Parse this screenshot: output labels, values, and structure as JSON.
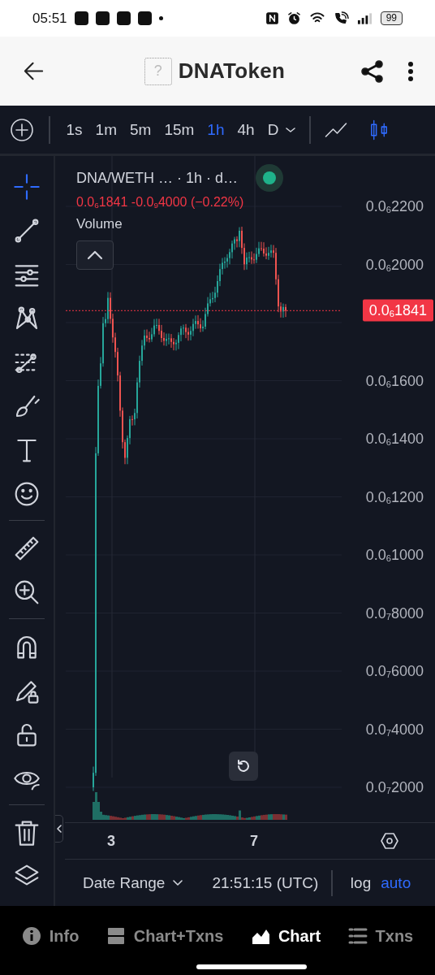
{
  "status_bar": {
    "time": "05:51",
    "battery": "99"
  },
  "header": {
    "token_placeholder": "?",
    "title": "DNAToken"
  },
  "toolbar": {
    "intervals": [
      {
        "label": "1s",
        "selected": false
      },
      {
        "label": "1m",
        "selected": false
      },
      {
        "label": "5m",
        "selected": false
      },
      {
        "label": "15m",
        "selected": false
      },
      {
        "label": "1h",
        "selected": true
      },
      {
        "label": "4h",
        "selected": false
      },
      {
        "label": "D",
        "selected": false
      }
    ],
    "chart_types": [
      {
        "kind": "line",
        "selected": false
      },
      {
        "kind": "candles",
        "selected": true
      }
    ]
  },
  "tool_groups": [
    [
      {
        "kind": "crosshair",
        "selected": true
      },
      {
        "kind": "trend-line",
        "selected": false
      },
      {
        "kind": "lines",
        "selected": false
      },
      {
        "kind": "pattern",
        "selected": false
      },
      {
        "kind": "forecast",
        "selected": false
      },
      {
        "kind": "brush",
        "selected": false
      },
      {
        "kind": "text",
        "selected": false
      },
      {
        "kind": "emoji",
        "selected": false
      }
    ],
    [
      {
        "kind": "ruler",
        "selected": false
      },
      {
        "kind": "zoom",
        "selected": false
      }
    ],
    [
      {
        "kind": "magnet",
        "selected": false
      },
      {
        "kind": "lock-drawing",
        "selected": false
      },
      {
        "kind": "unlock",
        "selected": false
      },
      {
        "kind": "eye",
        "selected": false
      }
    ],
    [
      {
        "kind": "trash",
        "selected": false
      },
      {
        "kind": "layers",
        "selected": false
      }
    ]
  ],
  "legend": {
    "symbol": "DNA/WETH …  · 1h · d…",
    "quote": "0.0$_{6}$1841  -0.0$_{9}$4000 (−0.22%)",
    "study": "Volume"
  },
  "price_axis": [
    "0.0$_{6}$2200",
    "0.0$_{6}$2000",
    "0.0$_{6}$1600",
    "0.0$_{6}$1400",
    "0.0$_{6}$1200",
    "0.0$_{6}$1000",
    "0.0$_{7}$8000",
    "0.0$_{7}$6000",
    "0.0$_{7}$4000",
    "0.0$_{7}$2000"
  ],
  "last_price": "0.0$_{6}$1841",
  "time_axis": [
    "3",
    "7"
  ],
  "bottom_bar": {
    "date_range": "Date Range",
    "clock": "21:51:15 (UTC)",
    "scales": [
      {
        "label": "log",
        "selected": false
      },
      {
        "label": "auto",
        "selected": true
      }
    ]
  },
  "nav": [
    {
      "kind": "info",
      "label": "Info",
      "selected": false
    },
    {
      "kind": "split",
      "label": "Chart+Txns",
      "selected": false
    },
    {
      "kind": "chart",
      "label": "Chart",
      "selected": true
    },
    {
      "kind": "list",
      "label": "Txns",
      "selected": false
    }
  ]
}
